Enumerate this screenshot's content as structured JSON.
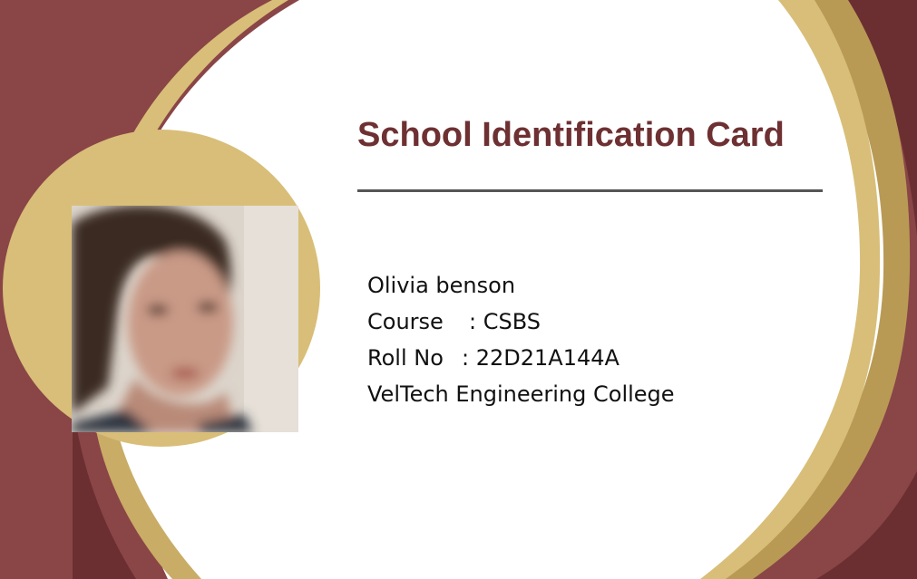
{
  "card": {
    "title": "School Identification Card",
    "student": {
      "name": "Olivia benson",
      "course_label": "Course",
      "course_value": ": CSBS",
      "roll_label": "Roll No",
      "roll_value": ": 22D21A144A",
      "college": "VelTech Engineering College"
    },
    "photo": {
      "description_icon": "student-photo"
    }
  },
  "colors": {
    "maroon_dark": "#6b2f31",
    "maroon": "#8a4547",
    "gold": "#d8be78",
    "gold_dark": "#b89a55",
    "title_text": "#6e3032",
    "rule": "#555555"
  }
}
